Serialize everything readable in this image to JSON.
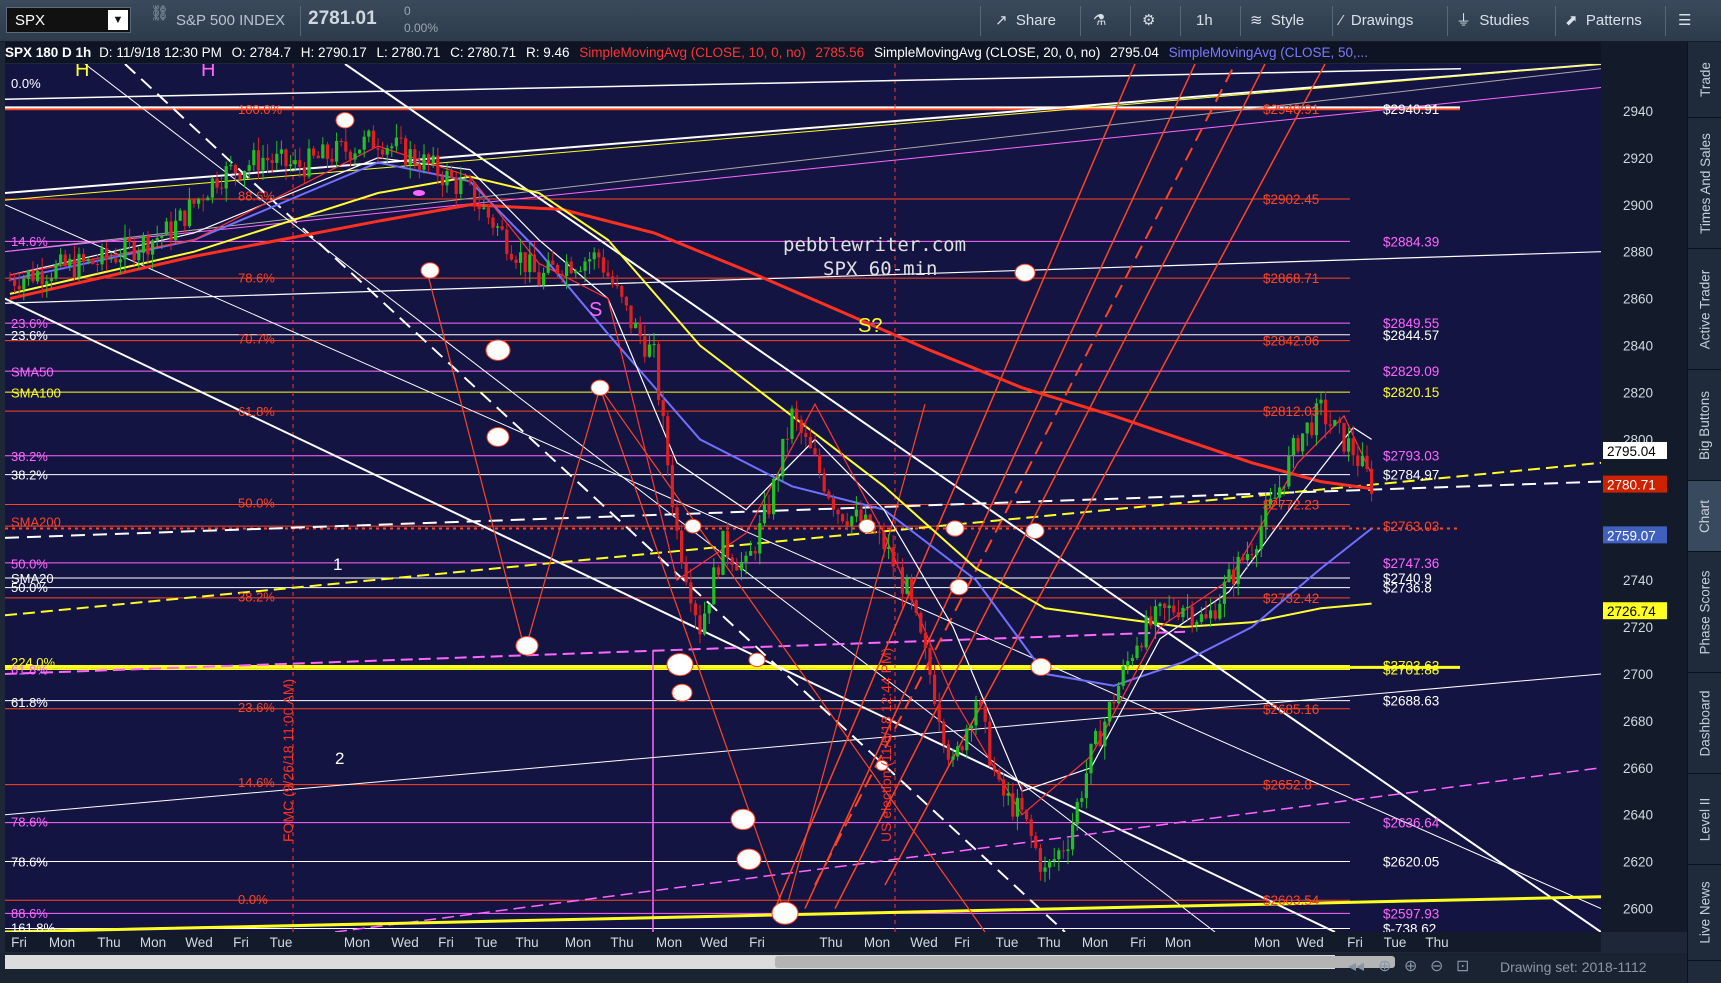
{
  "toolbar": {
    "symbol": "SPX",
    "index_name": "S&P 500 INDEX",
    "last_price": "2781.01",
    "change": "0",
    "change_pct": "0.00%",
    "buttons": [
      "Share",
      "1h",
      "Style",
      "Drawings",
      "Studies",
      "Patterns"
    ]
  },
  "infobar": {
    "header": "SPX 180 D 1h",
    "date": "D: 11/9/18 12:30 PM",
    "open": "O: 2784.7",
    "high": "H: 2790.17",
    "low": "L: 2780.71",
    "close": "C: 2780.71",
    "range": "R: 9.46",
    "sma10_label": "SimpleMovingAvg (CLOSE, 10, 0, no)",
    "sma10_value": "2785.56",
    "sma20_label": "SimpleMovingAvg (CLOSE, 20, 0, no)",
    "sma20_value": "2795.04",
    "sma50_label": "SimpleMovingAvg (CLOSE, 50,..."
  },
  "sidebar": {
    "tabs": [
      "Trade",
      "Times And Sales",
      "Active Trader",
      "Big Buttons",
      "Chart",
      "Phase Scores",
      "Dashboard",
      "Level II",
      "Live News"
    ]
  },
  "bottombar": {
    "drawing_set": "Drawing set: 2018-1112"
  },
  "colors": {
    "background": "#141443",
    "candle_up": "#22c022",
    "candle_down": "#e02020",
    "sma10": "#ff3333",
    "sma20": "#ffffff",
    "sma50": "#7070ff",
    "sma100": "#ffff33",
    "sma200": "#ff3020",
    "fib_red": "#ff4422",
    "fib_pink": "#ff66ff",
    "white_lines": "#ffffff",
    "yellow_lines": "#ffff22"
  },
  "chart_data": {
    "type": "candlestick",
    "title": "pebblewriter.com",
    "subtitle": "SPX 60-min",
    "ylim": [
      2590,
      2960
    ],
    "y_ticks": [
      2600,
      2620,
      2640,
      2660,
      2680,
      2700,
      2720,
      2740,
      2760,
      2780,
      2800,
      2820,
      2840,
      2860,
      2880,
      2900,
      2920,
      2940
    ],
    "x_ticks": [
      "Fri",
      "Mon",
      "Thu",
      "Mon",
      "Wed",
      "Fri",
      "Tue",
      "Mon",
      "Wed",
      "Fri",
      "Tue",
      "Thu",
      "Mon",
      "Thu",
      "Mon",
      "Wed",
      "Fri",
      "Thu",
      "Mon",
      "Wed",
      "Fri",
      "Tue",
      "Thu",
      "Mon",
      "Fri",
      "Mon",
      "Mon",
      "Wed",
      "Fri",
      "Tue",
      "Thu"
    ],
    "price_path": [
      [
        0,
        2868
      ],
      [
        8,
        2872
      ],
      [
        20,
        2876
      ],
      [
        35,
        2889
      ],
      [
        45,
        2912
      ],
      [
        55,
        2920
      ],
      [
        62,
        2916
      ],
      [
        72,
        2923
      ],
      [
        80,
        2928
      ],
      [
        90,
        2918
      ],
      [
        100,
        2905
      ],
      [
        108,
        2885
      ],
      [
        115,
        2868
      ],
      [
        120,
        2875
      ],
      [
        128,
        2878
      ],
      [
        135,
        2850
      ],
      [
        140,
        2835
      ],
      [
        145,
        2760
      ],
      [
        150,
        2720
      ],
      [
        155,
        2755
      ],
      [
        160,
        2745
      ],
      [
        165,
        2772
      ],
      [
        170,
        2810
      ],
      [
        175,
        2790
      ],
      [
        180,
        2770
      ],
      [
        185,
        2765
      ],
      [
        190,
        2755
      ],
      [
        195,
        2735
      ],
      [
        200,
        2700
      ],
      [
        205,
        2660
      ],
      [
        210,
        2690
      ],
      [
        215,
        2650
      ],
      [
        220,
        2640
      ],
      [
        225,
        2615
      ],
      [
        230,
        2630
      ],
      [
        235,
        2665
      ],
      [
        240,
        2690
      ],
      [
        245,
        2715
      ],
      [
        250,
        2725
      ],
      [
        255,
        2730
      ],
      [
        260,
        2722
      ],
      [
        265,
        2740
      ],
      [
        270,
        2755
      ],
      [
        275,
        2775
      ],
      [
        280,
        2800
      ],
      [
        285,
        2812
      ],
      [
        288,
        2804
      ],
      [
        292,
        2795
      ],
      [
        296,
        2781
      ]
    ],
    "right_labels": [
      {
        "value": 2940.91,
        "text": "$2940.91",
        "color": "#ffffff"
      },
      {
        "value": 2940.91,
        "text": "$2940.91",
        "color": "#ff4422",
        "col": "left"
      },
      {
        "value": 2902.45,
        "text": "$2902.45",
        "color": "#ff4422",
        "col": "left"
      },
      {
        "value": 2884.39,
        "text": "$2884.39",
        "color": "#ff66ff"
      },
      {
        "value": 2868.71,
        "text": "$2868.71",
        "color": "#ff4422",
        "col": "left"
      },
      {
        "value": 2849.55,
        "text": "$2849.55",
        "color": "#ff66ff"
      },
      {
        "value": 2844.57,
        "text": "$2844.57",
        "color": "#ffffff"
      },
      {
        "value": 2842.06,
        "text": "$2842.06",
        "color": "#ff4422",
        "col": "left"
      },
      {
        "value": 2829.09,
        "text": "$2829.09",
        "color": "#ff66ff"
      },
      {
        "value": 2820.15,
        "text": "$2820.15",
        "color": "#ffff22"
      },
      {
        "value": 2812.03,
        "text": "$2812.03",
        "color": "#ff4422",
        "col": "left"
      },
      {
        "value": 2793.03,
        "text": "$2793.03",
        "color": "#ff66ff"
      },
      {
        "value": 2784.97,
        "text": "$2784.97",
        "color": "#ffffff"
      },
      {
        "value": 2772.23,
        "text": "$2772.23",
        "color": "#ff4422",
        "col": "left"
      },
      {
        "value": 2763.03,
        "text": "$2763.03",
        "color": "#ff4422"
      },
      {
        "value": 2747.36,
        "text": "$2747.36",
        "color": "#ff66ff"
      },
      {
        "value": 2740.9,
        "text": "$2740.9",
        "color": "#ffffff"
      },
      {
        "value": 2736.8,
        "text": "$2736.8",
        "color": "#ffffff"
      },
      {
        "value": 2732.42,
        "text": "$2732.42",
        "color": "#ff4422",
        "col": "left"
      },
      {
        "value": 2703.62,
        "text": "$2703.62",
        "color": "#ffff22"
      },
      {
        "value": 2701.88,
        "text": "$2701.88",
        "color": "#ffff22"
      },
      {
        "value": 2688.63,
        "text": "$2688.63",
        "color": "#ffffff"
      },
      {
        "value": 2685.16,
        "text": "$2685.16",
        "color": "#ff4422",
        "col": "left"
      },
      {
        "value": 2652.8,
        "text": "$2652.8",
        "color": "#ff4422",
        "col": "left"
      },
      {
        "value": 2636.64,
        "text": "$2636.64",
        "color": "#ff66ff"
      },
      {
        "value": 2620.05,
        "text": "$2620.05",
        "color": "#ffffff"
      },
      {
        "value": 2603.54,
        "text": "$2603.54",
        "color": "#ff4422",
        "col": "left"
      },
      {
        "value": 2597.93,
        "text": "$2597.93",
        "color": "#ff66ff"
      },
      {
        "value": 2591.5,
        "text": "$-738.62",
        "color": "#ffffff"
      }
    ],
    "axis_badges": [
      {
        "value": 2795.04,
        "text": "2795.04",
        "bg": "#ffffff",
        "fg": "#000000"
      },
      {
        "value": 2780.71,
        "text": "2780.71",
        "bg": "#cc2200",
        "fg": "#ffffff"
      },
      {
        "value": 2759.07,
        "text": "2759.07",
        "bg": "#4060c0",
        "fg": "#ffffff"
      },
      {
        "value": 2726.74,
        "text": "2726.74",
        "bg": "#ffff22",
        "fg": "#000000"
      }
    ],
    "left_labels": [
      {
        "value": 2952,
        "text": "0.0%",
        "color": "#ffffff"
      },
      {
        "value": 2884.5,
        "text": "14.6%",
        "color": "#ff66ff"
      },
      {
        "value": 2849.5,
        "text": "23.6%",
        "color": "#ff66ff"
      },
      {
        "value": 2844.5,
        "text": "23.6%",
        "color": "#ffffff"
      },
      {
        "value": 2829,
        "text": "SMA50",
        "color": "#ff66ff"
      },
      {
        "value": 2820,
        "text": "SMA100",
        "color": "#ffff22"
      },
      {
        "value": 2793,
        "text": "38.2%",
        "color": "#ff66ff"
      },
      {
        "value": 2785,
        "text": "38.2%",
        "color": "#ffffff"
      },
      {
        "value": 2765,
        "text": "SMA200",
        "color": "#ff4422"
      },
      {
        "value": 2747,
        "text": "50.0%",
        "color": "#ff66ff"
      },
      {
        "value": 2741,
        "text": "SMA20",
        "color": "#ffffff"
      },
      {
        "value": 2737,
        "text": "50.0%",
        "color": "#ffffff"
      },
      {
        "value": 2705,
        "text": "224.0%",
        "color": "#ffff22"
      },
      {
        "value": 2702,
        "text": "61.8%",
        "color": "#ff66ff"
      },
      {
        "value": 2688,
        "text": "61.8%",
        "color": "#ffffff"
      },
      {
        "value": 2637,
        "text": "78.6%",
        "color": "#ff66ff"
      },
      {
        "value": 2620,
        "text": "78.6%",
        "color": "#ffffff"
      },
      {
        "value": 2598,
        "text": "88.6%",
        "color": "#ff66ff"
      },
      {
        "value": 2592,
        "text": "161.8%",
        "color": "#ffffff"
      }
    ],
    "fib_labels": [
      {
        "value": 2940.9,
        "text": "100.0%"
      },
      {
        "value": 2904,
        "text": "88.6%"
      },
      {
        "value": 2869,
        "text": "78.6%"
      },
      {
        "value": 2843,
        "text": "70.7%"
      },
      {
        "value": 2812,
        "text": "61.8%"
      },
      {
        "value": 2773,
        "text": "50.0%"
      },
      {
        "value": 2733,
        "text": "38.2%"
      },
      {
        "value": 2686,
        "text": "23.6%"
      },
      {
        "value": 2654,
        "text": "14.6%"
      },
      {
        "value": 2604,
        "text": "0.0%"
      }
    ],
    "annotations": [
      {
        "text": "H",
        "color": "#ffff22"
      },
      {
        "text": "H",
        "color": "#ff66ff"
      },
      {
        "text": "S",
        "color": "#ff66ff"
      },
      {
        "text": "S?",
        "color": "#ffff22"
      },
      {
        "text": "1",
        "color": "#ffffff"
      },
      {
        "text": "2",
        "color": "#ffffff"
      },
      {
        "text": "FOMC (9/26/18 11:00 AM)",
        "color": "#ff3322"
      },
      {
        "text": "US election (11/6/18 12:44 PM)",
        "color": "#ff3322"
      }
    ]
  }
}
